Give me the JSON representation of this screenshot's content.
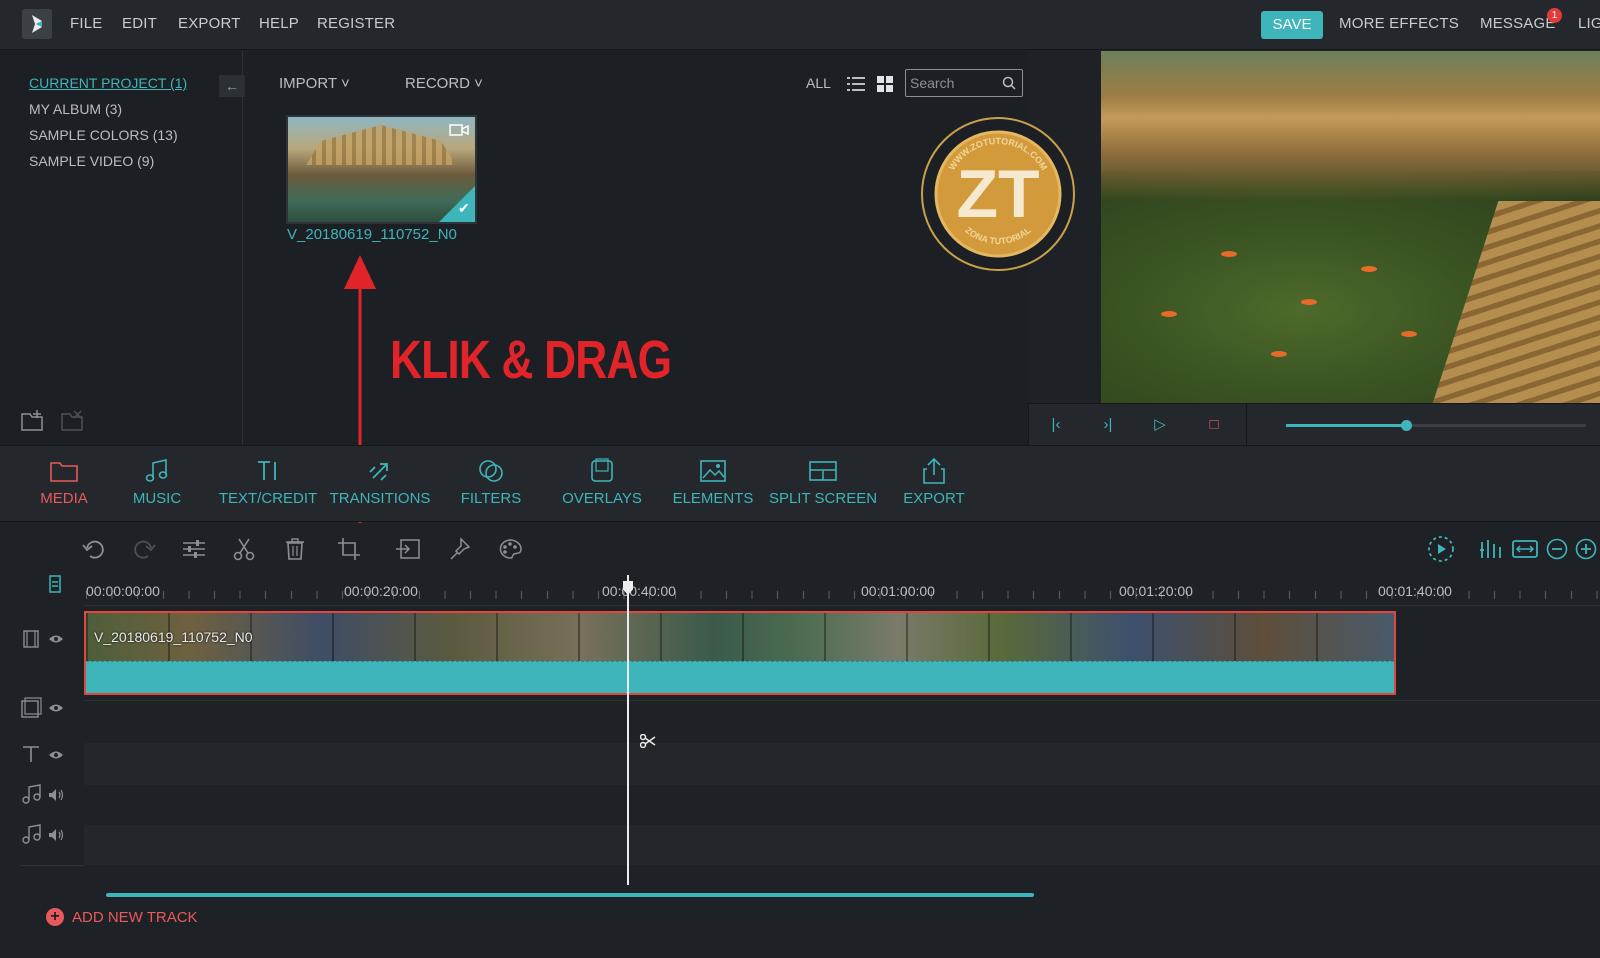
{
  "menubar": {
    "items": [
      "FILE",
      "EDIT",
      "EXPORT",
      "HELP",
      "REGISTER"
    ],
    "save_label": "SAVE",
    "more_effects": "MORE EFFECTS",
    "message": "MESSAGE",
    "message_badge": "1",
    "light": "LIG"
  },
  "library": {
    "sidebar": [
      {
        "label": "CURRENT PROJECT (1)",
        "active": true
      },
      {
        "label": "MY ALBUM (3)",
        "active": false
      },
      {
        "label": "SAMPLE COLORS (13)",
        "active": false
      },
      {
        "label": "SAMPLE VIDEO (9)",
        "active": false
      }
    ],
    "import_label": "IMPORT",
    "record_label": "RECORD",
    "view_all": "ALL",
    "search_placeholder": "Search",
    "clip_name": "V_20180619_110752_N0"
  },
  "watermark": {
    "initials": "ZT",
    "top_text": "WWW.ZOTUTORIAL.COM",
    "bottom_text": "ZONA TUTORIAL"
  },
  "annotation": {
    "text": "KLIK & DRAG"
  },
  "preview": {
    "progress": 0.4
  },
  "tabs": [
    {
      "label": "MEDIA",
      "icon": "folder-icon",
      "active": true
    },
    {
      "label": "MUSIC",
      "icon": "music-note-icon",
      "active": false
    },
    {
      "label": "TEXT/CREDIT",
      "icon": "text-icon",
      "active": false
    },
    {
      "label": "TRANSITIONS",
      "icon": "transition-icon",
      "active": false
    },
    {
      "label": "FILTERS",
      "icon": "filter-icon",
      "active": false
    },
    {
      "label": "OVERLAYS",
      "icon": "overlay-icon",
      "active": false
    },
    {
      "label": "ELEMENTS",
      "icon": "image-icon",
      "active": false
    },
    {
      "label": "SPLIT SCREEN",
      "icon": "split-screen-icon",
      "active": false
    },
    {
      "label": "EXPORT",
      "icon": "share-icon",
      "active": false
    }
  ],
  "timeline": {
    "ruler_labels": [
      "00:00:00:00",
      "00:00:20:00",
      "00:00:40:00",
      "00:01:00:00",
      "00:01:20:00",
      "00:01:40:00"
    ],
    "clip_label": "V_20180619_110752_N0",
    "add_track_label": "ADD NEW TRACK"
  },
  "colors": {
    "accent": "#3eb5ba",
    "active_tab": "#e85a5a",
    "annotation": "#e0242a",
    "background": "#1e2226"
  }
}
